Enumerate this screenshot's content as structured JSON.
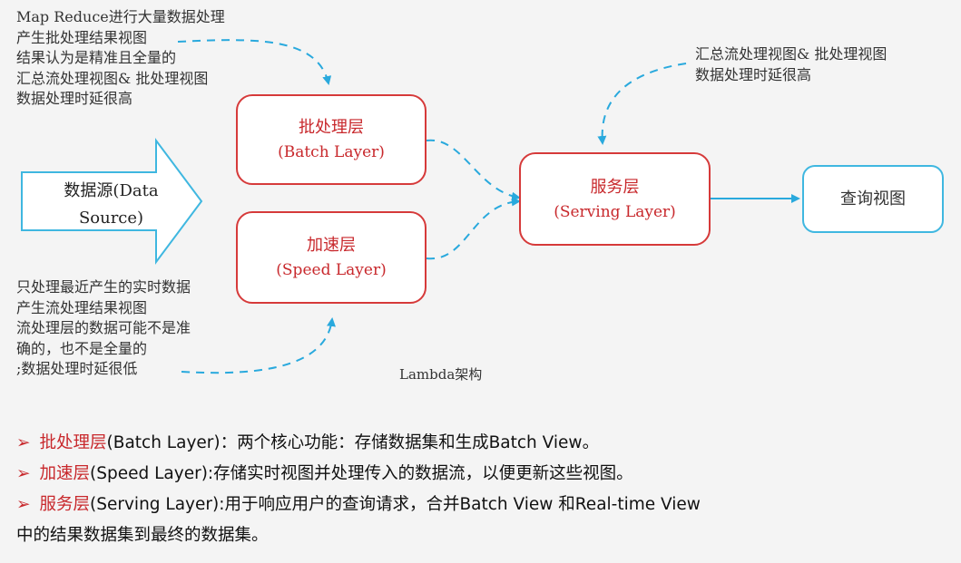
{
  "notes": {
    "top_left": "Map Reduce进行大量数据处理\n产生批处理结果视图\n结果认为是精准且全量的\n汇总流处理视图& 批处理视图\n数据处理时延很高",
    "top_right": "汇总流处理视图& 批处理视图\n数据处理时延很高",
    "bottom_left": "只处理最近产生的实时数据\n产生流处理结果视图\n流处理层的数据可能不是准\n确的，也不是全量的\n;数据处理时延很低"
  },
  "source": {
    "line1": "数据源(Data",
    "line2": "Source)"
  },
  "layers": {
    "batch": {
      "cn": "批处理层",
      "en": "(Batch Layer)"
    },
    "speed": {
      "cn": "加速层",
      "en": "(Speed Layer)"
    },
    "serving": {
      "cn": "服务层",
      "en": "(Serving Layer)"
    }
  },
  "query_view": "查询视图",
  "caption": "Lambda架构",
  "bullets": [
    {
      "mark": "➢",
      "term": "批处理层",
      "rest": "(Batch Layer)：两个核心功能：存储数据集和生成Batch View。"
    },
    {
      "mark": "➢",
      "term": "加速层",
      "rest": "(Speed Layer):存储实时视图并处理传入的数据流，以便更新这些视图。"
    },
    {
      "mark": "➢",
      "term": "服务层",
      "rest": "(Serving Layer):用于响应用户的查询请求，合并Batch View 和Real-time View"
    }
  ],
  "bullet_continuation": "中的结果数据集到最终的数据集。",
  "colors": {
    "layer_border": "#d63a3a",
    "layer_text": "#c8282c",
    "accent_blue": "#3fb7e0",
    "arrow_blue": "#29a9dd"
  }
}
